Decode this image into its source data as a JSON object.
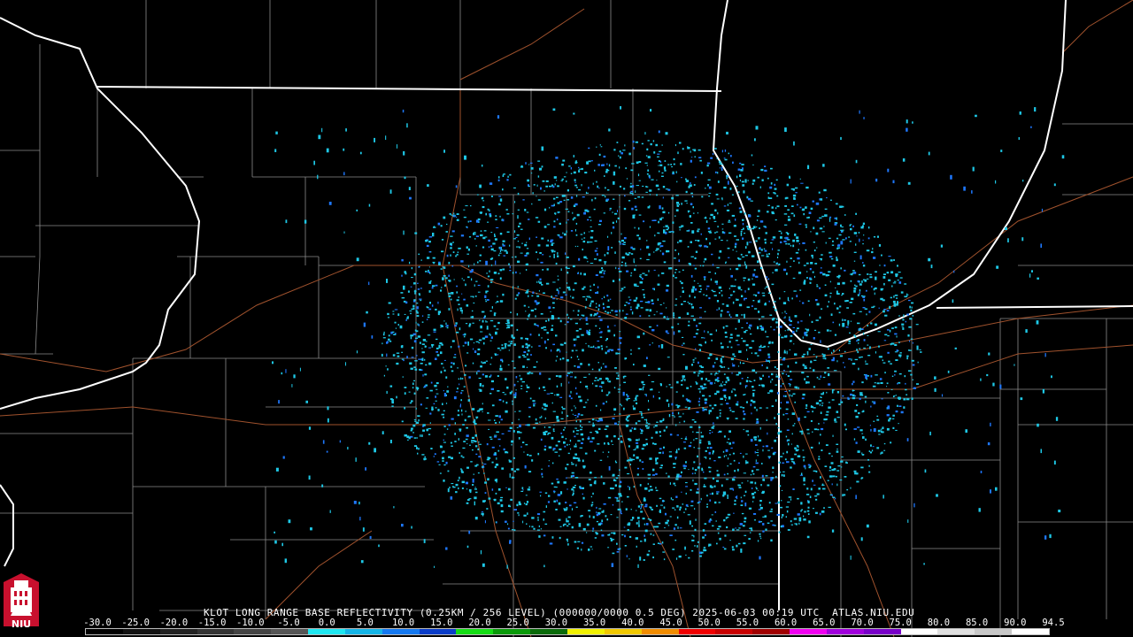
{
  "product": {
    "caption": "KLOT LONG RANGE BASE REFLECTIVITY (0.25KM / 256 LEVEL) (000000/0000 0.5 DEG) 2025-06-03 00:19 UTC  ATLAS.NIU.EDU"
  },
  "logo": {
    "label": "NIU",
    "icon": "university-tower-icon",
    "colors": [
      "#c8102e",
      "#ffffff"
    ]
  },
  "map_colors": {
    "background": "#000000",
    "state_border": "#ffffff",
    "county_line": "#8a8a8a",
    "highway": "#a0522d",
    "echo_primary": "#1ec8e6",
    "echo_secondary": "#1e78ff"
  },
  "scale": {
    "labels": [
      "-30.0",
      "-25.0",
      "-20.0",
      "-15.0",
      "-10.0",
      "-5.0",
      "0.0",
      "5.0",
      "10.0",
      "15.0",
      "20.0",
      "25.0",
      "30.0",
      "35.0",
      "40.0",
      "45.0",
      "50.0",
      "55.0",
      "60.0",
      "65.0",
      "70.0",
      "75.0",
      "80.0",
      "85.0",
      "90.0",
      "94.5"
    ],
    "colors": [
      "#000000",
      "#111111",
      "#222222",
      "#333333",
      "#444444",
      "#555555",
      "#1ee6f0",
      "#14b4e6",
      "#1478f0",
      "#0a3cc8",
      "#14dc14",
      "#0a9a0a",
      "#0a6a0a",
      "#f0f000",
      "#f0c800",
      "#f08c00",
      "#f00000",
      "#c80000",
      "#a00000",
      "#f000f0",
      "#a000dc",
      "#7800c8",
      "#ffffff",
      "#e0e0e0",
      "#c8c8c8",
      "#ffffff"
    ]
  }
}
